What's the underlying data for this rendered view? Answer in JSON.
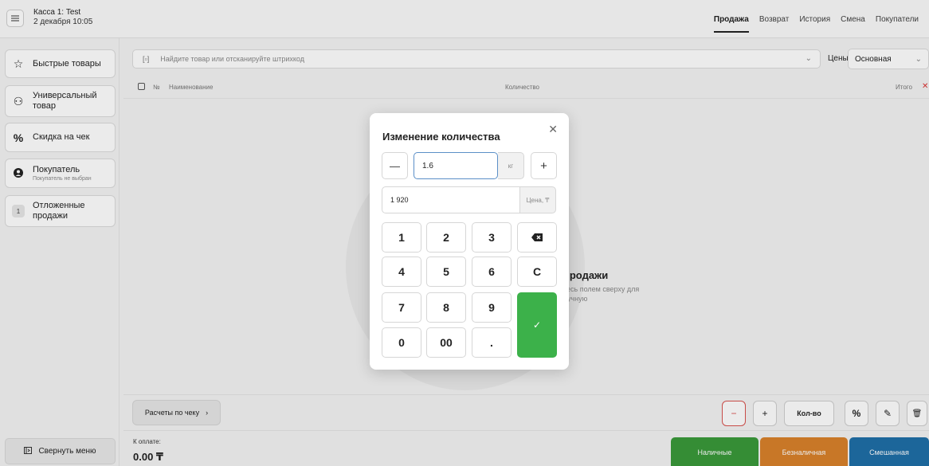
{
  "header": {
    "register_name": "Касса 1: Test",
    "datetime": "2 декабря 10:05",
    "menu_icon": "hamburger-icon",
    "tabs": [
      {
        "label": "Продажа",
        "active": true
      },
      {
        "label": "Возврат",
        "active": false
      },
      {
        "label": "История",
        "active": false
      },
      {
        "label": "Смена",
        "active": false
      },
      {
        "label": "Покупатели",
        "active": false
      }
    ]
  },
  "sidebar": {
    "items": [
      {
        "label": "Быстрые товары",
        "icon": "star-icon"
      },
      {
        "label": "Универсальный товар",
        "icon": "box-icon"
      },
      {
        "label": "Скидка на чек",
        "icon": "percent-icon"
      },
      {
        "label": "Покупатель",
        "sublabel": "Покупатель не выбран",
        "icon": "user-icon"
      },
      {
        "label": "Отложенные продажи",
        "badge": "1"
      }
    ],
    "collapse_label": "Свернуть меню"
  },
  "search": {
    "placeholder": "Найдите товар или отсканируйте штрихкод",
    "prices_label": "Цены",
    "prices_value": "Основная"
  },
  "table": {
    "headers": {
      "number": "№",
      "name": "Наименование",
      "quantity": "Количество",
      "total": "Итого",
      "clear": "✕"
    }
  },
  "empty_state": {
    "title": "продажи",
    "hint_line1": "тесь полем сверху для",
    "hint_line2": "ручную"
  },
  "bottom": {
    "calc_label": "Расчеты по чеку",
    "minus": "−",
    "plus": "+",
    "qty_label": "Кол-во",
    "discount": "%",
    "edit": "✎",
    "delete": "🗑"
  },
  "payment": {
    "label": "К оплате:",
    "total": "0.00 ₸",
    "cash": {
      "label": "Наличные",
      "color": "#3a9a3a"
    },
    "card": {
      "label": "Безналичная",
      "color": "#d9822b"
    },
    "mixed": {
      "label": "Смешанная",
      "color": "#1f6fa8"
    }
  },
  "dialog": {
    "title": "Изменение количества",
    "quantity": "1.6",
    "unit": "кг",
    "price": "1 920",
    "price_unit": "Цена, ₸",
    "keys": [
      "1",
      "2",
      "3",
      "4",
      "5",
      "6",
      "7",
      "8",
      "9",
      "0",
      "00",
      "."
    ],
    "clear_key": "C",
    "ok_key": "✓",
    "accent_color": "#3cb14a"
  }
}
